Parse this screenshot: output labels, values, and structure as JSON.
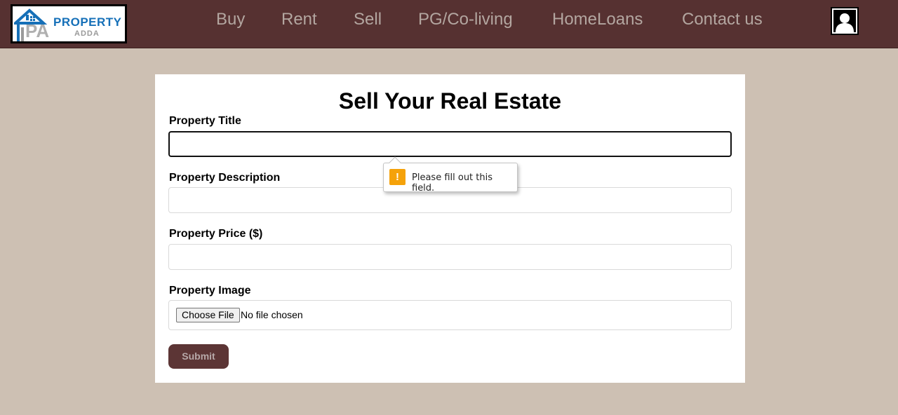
{
  "brand": {
    "name": "PROPERTY",
    "sub": "ADDA",
    "initials": "PA"
  },
  "nav": [
    "Buy",
    "Rent",
    "Sell",
    "PG/Co-living",
    "HomeLoans",
    "Contact us"
  ],
  "form": {
    "title": "Sell Your Real Estate",
    "fields": {
      "title_label": "Property Title",
      "title_value": "",
      "description_label": "Property Description",
      "description_value": "",
      "price_label": "Property Price ($)",
      "price_value": "",
      "image_label": "Property Image",
      "choose_file": "Choose File",
      "no_file": "No file chosen"
    },
    "submit": "Submit"
  },
  "validation": {
    "message": "Please fill out this field."
  },
  "colors": {
    "navbar": "#563131",
    "background": "#cdc0b3",
    "button": "#5c3535",
    "warning": "#f5a20a"
  }
}
